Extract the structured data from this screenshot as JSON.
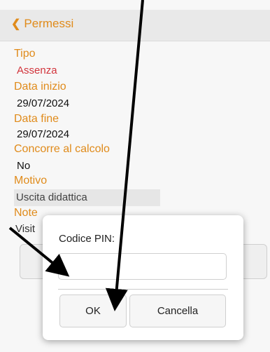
{
  "header": {
    "back_label": "Permessi"
  },
  "fields": {
    "tipo_label": "Tipo",
    "tipo_value": "Assenza",
    "data_inizio_label": "Data inizio",
    "data_inizio_value": "29/07/2024",
    "data_fine_label": "Data fine",
    "data_fine_value": "29/07/2024",
    "concorre_label": "Concorre al calcolo",
    "concorre_value": "No",
    "motivo_label": "Motivo",
    "motivo_value": "Uscita didattica",
    "note_label": "Note",
    "note_value": "Visit"
  },
  "dialog": {
    "pin_label": "Codice PIN:",
    "pin_value": "",
    "ok_label": "OK",
    "cancel_label": "Cancella"
  },
  "colors": {
    "accent": "#e8901c",
    "value_red": "#d9363e"
  }
}
